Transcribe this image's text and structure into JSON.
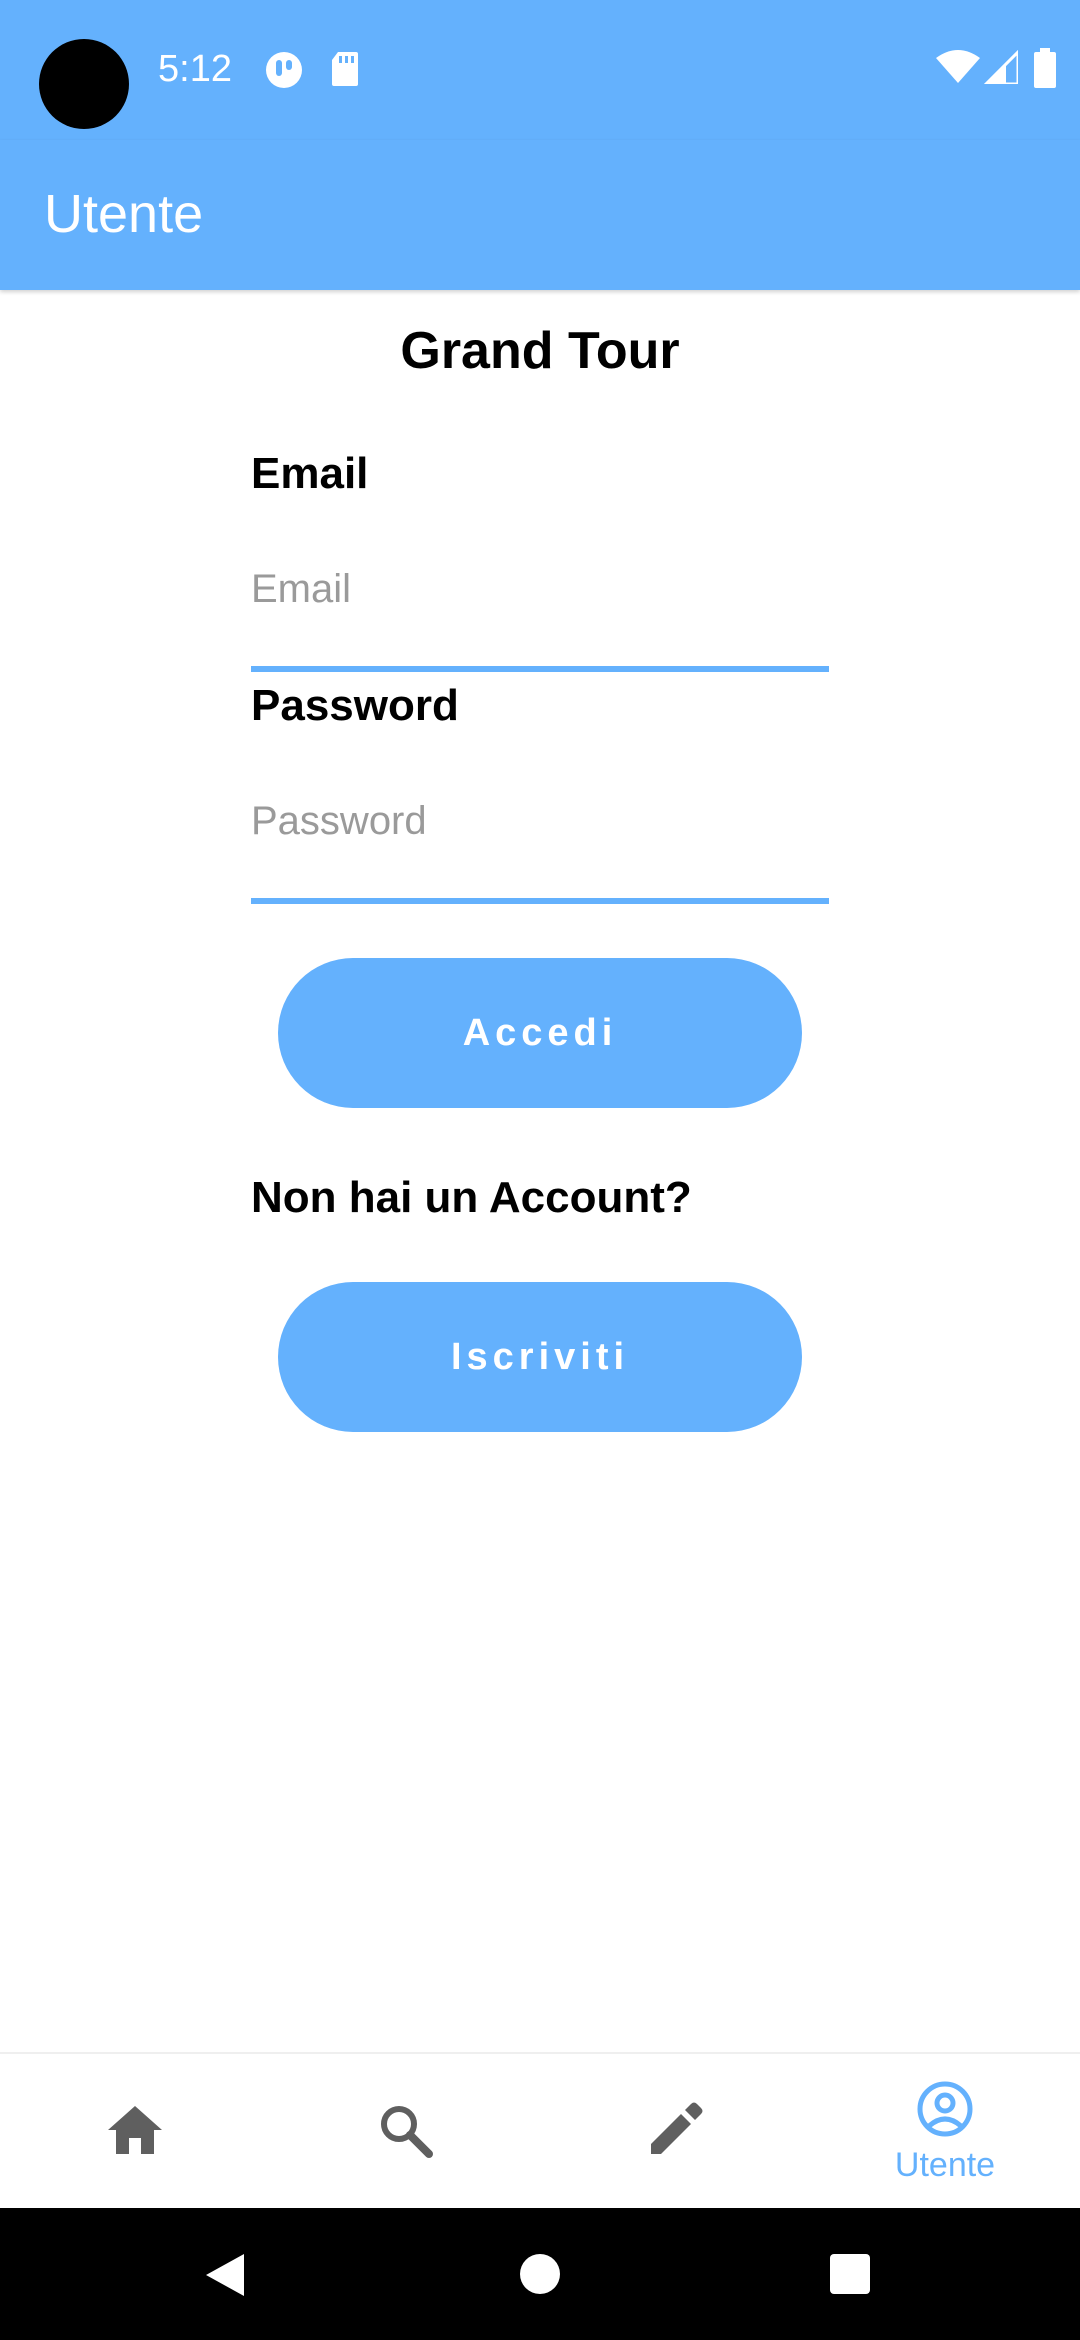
{
  "status_bar": {
    "time": "5:12",
    "icons": [
      "camera-hole",
      "app-notification-icon",
      "sd-card-icon",
      "wifi-icon",
      "signal-icon",
      "battery-icon"
    ]
  },
  "app_bar": {
    "title": "Utente"
  },
  "login": {
    "heading": "Grand Tour",
    "email_label": "Email",
    "email_placeholder": "Email",
    "email_value": "",
    "password_label": "Password",
    "password_placeholder": "Password",
    "password_value": "",
    "login_button": "Accedi",
    "signup_prompt": "Non hai un Account?",
    "signup_button": "Iscriviti"
  },
  "bottom_nav": {
    "items": [
      {
        "icon": "home-icon",
        "label": "",
        "active": false
      },
      {
        "icon": "search-icon",
        "label": "",
        "active": false
      },
      {
        "icon": "pencil-icon",
        "label": "",
        "active": false
      },
      {
        "icon": "account-circle-icon",
        "label": "Utente",
        "active": true
      }
    ]
  },
  "system_nav": [
    "back-icon",
    "home-circle-icon",
    "recents-icon"
  ],
  "colors": {
    "primary": "#64b1fd",
    "nav_inactive": "#5f5f5f",
    "system_bar": "#000000"
  }
}
